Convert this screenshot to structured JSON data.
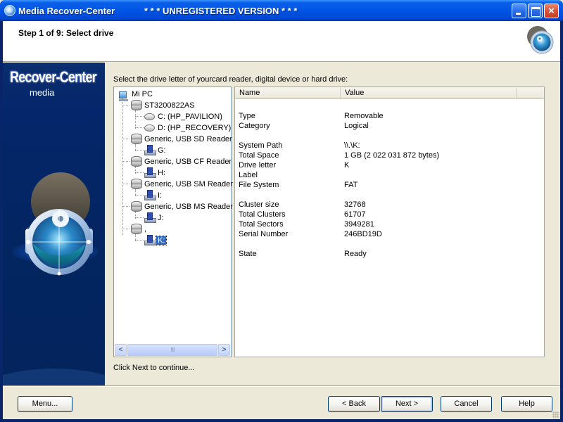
{
  "window": {
    "title": "Media Recover-Center",
    "unregistered_notice": "* * * UNREGISTERED VERSION * * *",
    "controls": {
      "minimize": "minimize",
      "maximize": "maximize",
      "close": "×"
    }
  },
  "header": {
    "step_title": "Step 1 of 9: Select drive",
    "logo_icon": "disc-magnifier-icon"
  },
  "sidebar": {
    "brand": "Recover-Center",
    "brand_sub": "media",
    "art_icon": "disc-magnifier-icon"
  },
  "instruction": "Select the drive letter of yourcard reader, digital device or hard drive:",
  "tree": {
    "items": [
      {
        "label": "Mi PC",
        "icon": "computer-icon",
        "level": 0
      },
      {
        "label": "ST3200822AS",
        "icon": "hard-disk-icon",
        "level": 1
      },
      {
        "label": "C: (HP_PAVILION)",
        "icon": "partition-icon",
        "level": 2
      },
      {
        "label": "D: (HP_RECOVERY)",
        "icon": "partition-icon",
        "level": 2
      },
      {
        "label": "Generic, USB SD Reader",
        "icon": "hard-disk-icon",
        "level": 1
      },
      {
        "label": "G:",
        "icon": "usb-drive-icon",
        "level": 2
      },
      {
        "label": "Generic, USB CF Reader",
        "icon": "hard-disk-icon",
        "level": 1
      },
      {
        "label": "H:",
        "icon": "usb-drive-icon",
        "level": 2
      },
      {
        "label": "Generic, USB SM Reader",
        "icon": "hard-disk-icon",
        "level": 1
      },
      {
        "label": "I:",
        "icon": "usb-drive-icon",
        "level": 2
      },
      {
        "label": "Generic, USB MS Reader",
        "icon": "hard-disk-icon",
        "level": 1
      },
      {
        "label": "J:",
        "icon": "usb-drive-icon",
        "level": 2
      },
      {
        "label": ",",
        "icon": "hard-disk-icon",
        "level": 1
      },
      {
        "label": "K:",
        "icon": "usb-drive-icon",
        "level": 2,
        "selected": true
      }
    ],
    "scrollbar": {
      "left_arrow": "<",
      "right_arrow": ">",
      "thumb_grip": "IIII"
    }
  },
  "properties": {
    "columns": {
      "name": "Name",
      "value": "Value"
    },
    "rows": [
      {
        "name": "Type",
        "value": "Removable"
      },
      {
        "name": "Category",
        "value": "Logical"
      },
      {
        "name": "System Path",
        "value": "\\\\.\\K:"
      },
      {
        "name": "Total Space",
        "value": "1 GB (2 022 031 872 bytes)"
      },
      {
        "name": "Drive letter",
        "value": "K"
      },
      {
        "name": "Label",
        "value": ""
      },
      {
        "name": "File System",
        "value": "FAT"
      },
      {
        "name": "Cluster size",
        "value": "32768"
      },
      {
        "name": "Total Clusters",
        "value": "61707"
      },
      {
        "name": "Total Sectors",
        "value": "3949281"
      },
      {
        "name": "Serial Number",
        "value": "246BD19D"
      },
      {
        "name": "State",
        "value": "Ready"
      }
    ]
  },
  "status_text": "Click Next to continue...",
  "buttons": {
    "menu": "Menu...",
    "back": "< Back",
    "next": "Next >",
    "cancel": "Cancel",
    "help": "Help"
  }
}
